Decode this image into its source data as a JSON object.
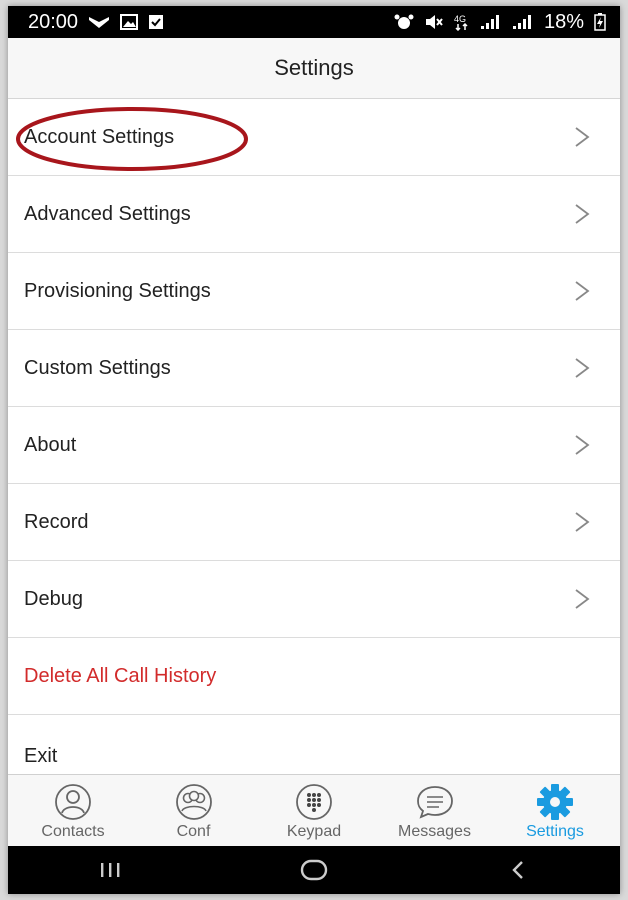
{
  "status_bar": {
    "time": "20:00",
    "battery": "18%",
    "left_icons": [
      "cast-icon",
      "image-icon",
      "checkbox-icon"
    ],
    "right_icons": [
      "alarm-icon",
      "mute-icon",
      "4g-icon",
      "signal-icon",
      "signal-icon",
      "battery-charging-icon"
    ]
  },
  "header": {
    "title": "Settings"
  },
  "menu": {
    "items": [
      {
        "label": "Account Settings",
        "chevron": true,
        "highlighted": true
      },
      {
        "label": "Advanced Settings",
        "chevron": true
      },
      {
        "label": "Provisioning Settings",
        "chevron": true
      },
      {
        "label": "Custom Settings",
        "chevron": true
      },
      {
        "label": "About",
        "chevron": true
      },
      {
        "label": "Record",
        "chevron": true
      },
      {
        "label": "Debug",
        "chevron": true
      },
      {
        "label": "Delete All Call History",
        "chevron": false,
        "color": "#d22b2b"
      },
      {
        "label": "Exit",
        "chevron": false
      }
    ]
  },
  "tab_bar": {
    "tabs": [
      {
        "label": "Contacts",
        "icon": "contact-icon"
      },
      {
        "label": "Conf",
        "icon": "conference-icon"
      },
      {
        "label": "Keypad",
        "icon": "keypad-icon"
      },
      {
        "label": "Messages",
        "icon": "message-icon"
      },
      {
        "label": "Settings",
        "icon": "gear-icon",
        "active": true
      }
    ],
    "active_color": "#1a9be0"
  },
  "nav_bar": {
    "buttons": [
      "recent-apps-icon",
      "home-icon",
      "back-icon"
    ]
  },
  "colors": {
    "highlight_ring": "#a8161c",
    "danger": "#d22b2b"
  }
}
